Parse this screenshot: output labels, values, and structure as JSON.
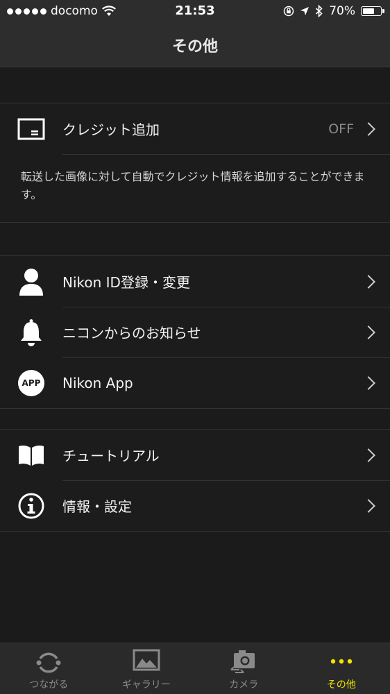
{
  "status_bar": {
    "carrier": "docomo",
    "time": "21:53",
    "battery": "70%",
    "battery_level": 0.7
  },
  "nav": {
    "title": "その他"
  },
  "credit": {
    "label": "クレジット追加",
    "value": "OFF",
    "description": "転送した画像に対して自動でクレジット情報を追加することができます。"
  },
  "menu1": [
    {
      "label": "Nikon ID登録・変更",
      "icon": "person-icon"
    },
    {
      "label": "ニコンからのお知らせ",
      "icon": "bell-icon"
    },
    {
      "label": "Nikon App",
      "icon": "app-icon",
      "badge": "APP"
    }
  ],
  "menu2": [
    {
      "label": "チュートリアル",
      "icon": "book-icon"
    },
    {
      "label": "情報・設定",
      "icon": "info-icon"
    }
  ],
  "tabs": [
    {
      "label": "つながる",
      "icon": "connect-icon"
    },
    {
      "label": "ギャラリー",
      "icon": "gallery-icon"
    },
    {
      "label": "カメラ",
      "icon": "camera-icon"
    },
    {
      "label": "その他",
      "icon": "more-icon",
      "active": true
    }
  ],
  "colors": {
    "accent": "#f5e300",
    "background": "#1b1b1b"
  }
}
